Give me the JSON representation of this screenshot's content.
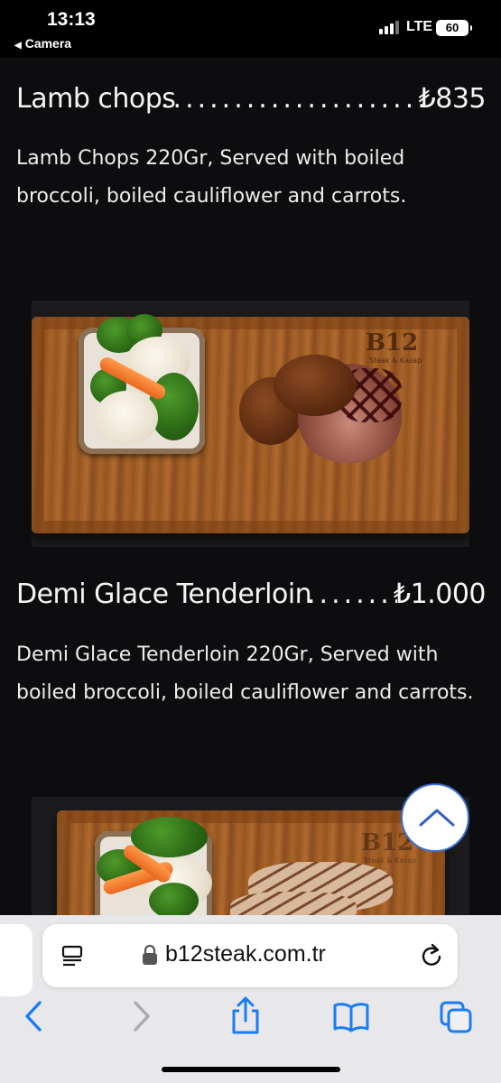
{
  "status_bar": {
    "time": "13:13",
    "back_app": "Camera",
    "network": "LTE",
    "battery": "60"
  },
  "menu_items": [
    {
      "name": "Lamb chops",
      "price": "₺835",
      "description": "Lamb Chops 220Gr, Served with boiled broccoli, boiled cauliflower and carrots."
    },
    {
      "name": "Demi Glace Tenderloin",
      "price": "₺1.000",
      "description": "Demi Glace Tenderloin 220Gr, Served with boiled broccoli, boiled cauliflower and carrots."
    }
  ],
  "photos": [
    {
      "brand_logo": "B12",
      "brand_sub": "Steak & Kasap"
    },
    {
      "brand_logo": "B12",
      "brand_sub": "Steak & Kasap"
    }
  ],
  "browser": {
    "url": "b12steak.com.tr"
  },
  "icons": [
    "back-arrow-icon",
    "forward-arrow-icon",
    "share-icon",
    "bookmarks-icon",
    "tabs-icon",
    "lock-icon",
    "reader-icon",
    "reload-icon",
    "chevron-up-icon"
  ],
  "colors": {
    "background": "#0d0d0f",
    "accent": "#1a7cf5"
  }
}
